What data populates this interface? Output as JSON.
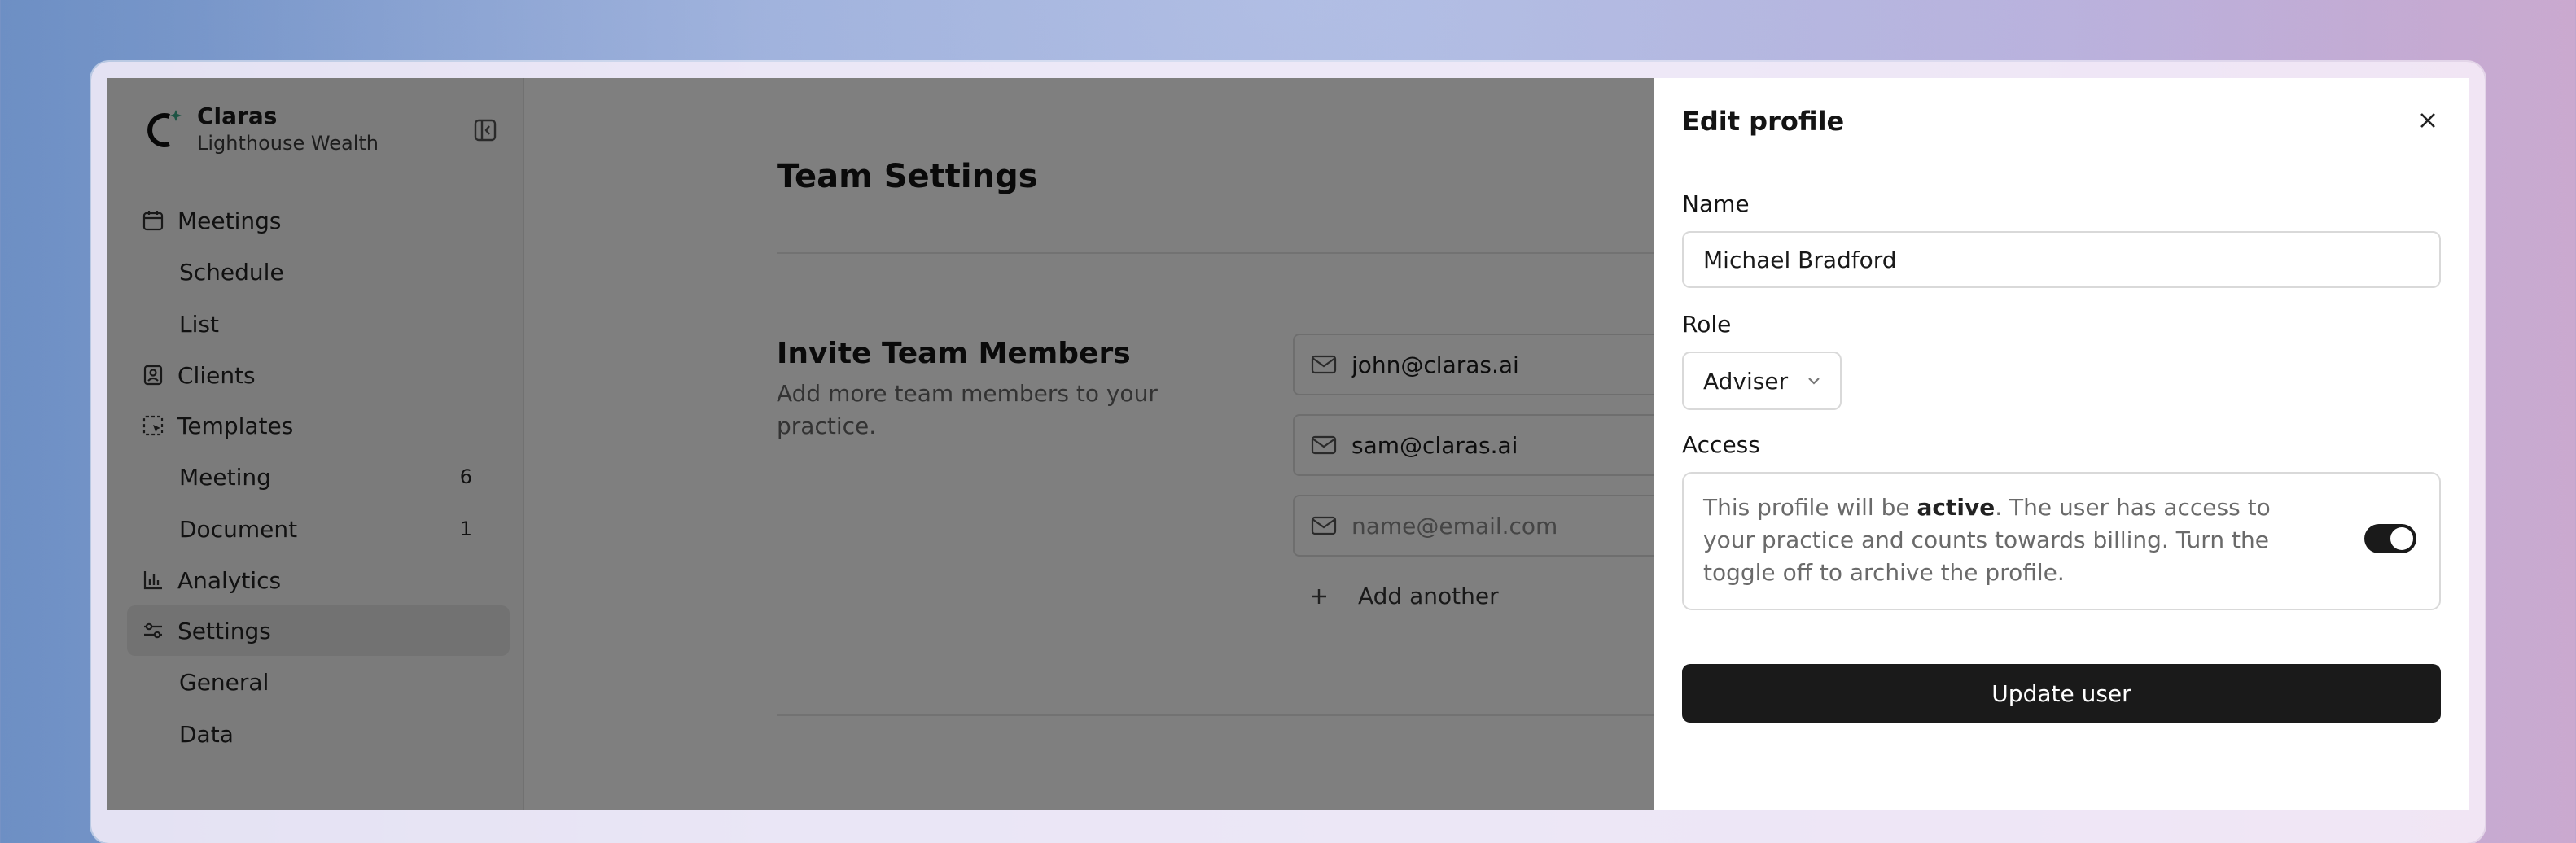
{
  "brand": {
    "name": "Claras",
    "organization": "Lighthouse Wealth",
    "logo_icon": "claras-logo-icon"
  },
  "sidebar": {
    "collapse_icon": "sidebar-collapse-icon",
    "items": [
      {
        "label": "Meetings",
        "icon": "calendar-icon"
      },
      {
        "label": "Schedule"
      },
      {
        "label": "List"
      },
      {
        "label": "Clients",
        "icon": "contact-card-icon"
      },
      {
        "label": "Templates",
        "icon": "template-icon"
      },
      {
        "label": "Meeting",
        "count": "6"
      },
      {
        "label": "Document",
        "count": "1"
      },
      {
        "label": "Analytics",
        "icon": "bar-chart-icon"
      },
      {
        "label": "Settings",
        "icon": "sliders-icon",
        "active": true
      },
      {
        "label": "General"
      },
      {
        "label": "Data"
      }
    ]
  },
  "main": {
    "title": "Team Settings",
    "invite": {
      "title": "Invite Team Members",
      "description": "Add more team members to your practice.",
      "emails": [
        "john@claras.ai",
        "sam@claras.ai"
      ],
      "placeholder": "name@email.com",
      "add_another": "Add another"
    }
  },
  "drawer": {
    "title": "Edit profile",
    "name_label": "Name",
    "name_value": "Michael Bradford",
    "role_label": "Role",
    "role_value": "Adviser",
    "access_label": "Access",
    "access_text_before": "This profile will be ",
    "access_text_bold": "active",
    "access_text_after": ". The user has access to your practice and counts towards billing. Turn the toggle off to archive the profile.",
    "access_toggle_on": true,
    "submit_label": "Update user"
  },
  "colors": {
    "primary": "#1a1a1a",
    "overlay": "rgba(0,0,0,0.5)",
    "sidebar_bg": "#f6f6f6"
  }
}
